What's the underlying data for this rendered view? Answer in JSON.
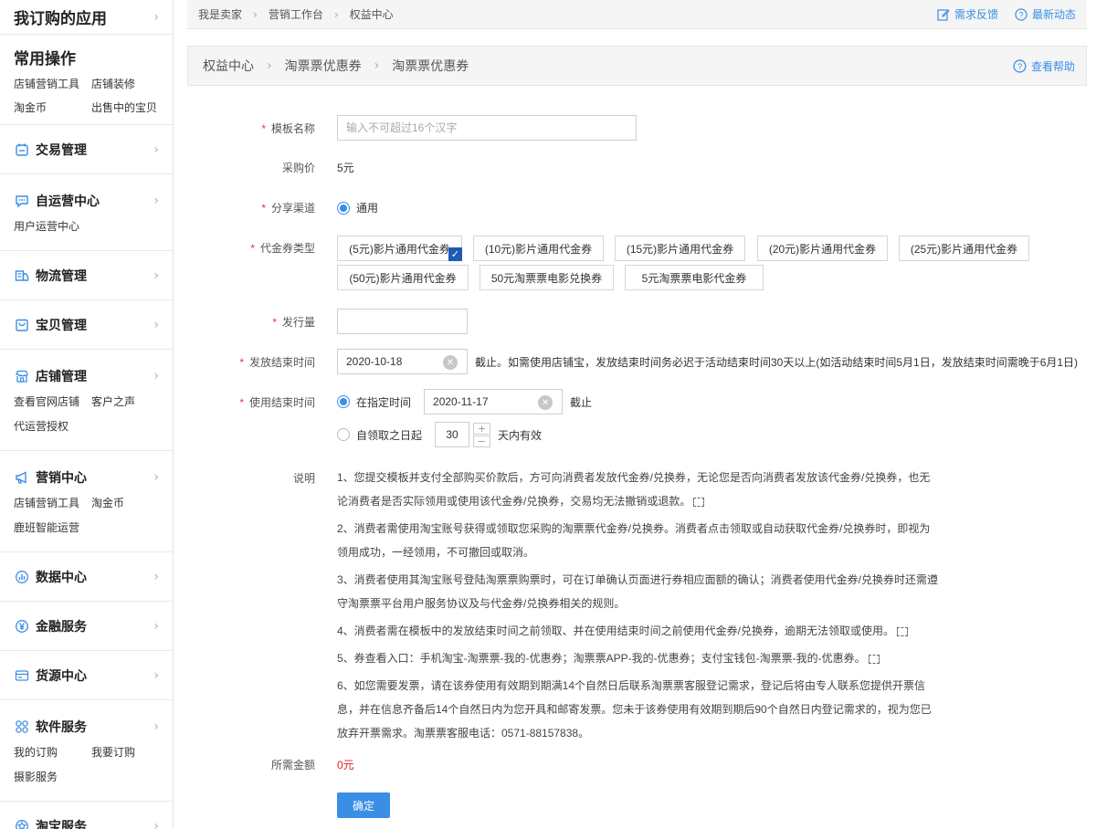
{
  "sidebar": {
    "subscribed_apps": "我订购的应用",
    "common": {
      "title": "常用操作",
      "links": [
        "店铺营销工具",
        "店铺装修",
        "淘金币",
        "出售中的宝贝"
      ]
    },
    "sections": [
      {
        "label": "交易管理",
        "icon": "calendar-icon",
        "sub": []
      },
      {
        "label": "自运营中心",
        "icon": "chat-icon",
        "sub": [
          "用户运营中心"
        ]
      },
      {
        "label": "物流管理",
        "icon": "truck-icon",
        "sub": []
      },
      {
        "label": "宝贝管理",
        "icon": "bag-icon",
        "sub": []
      },
      {
        "label": "店铺管理",
        "icon": "store-icon",
        "sub": [
          "查看官网店铺",
          "客户之声",
          "代运营授权"
        ]
      },
      {
        "label": "营销中心",
        "icon": "megaphone-icon",
        "sub": [
          "店铺营销工具",
          "淘金币",
          "鹿班智能运营"
        ]
      },
      {
        "label": "数据中心",
        "icon": "chart-icon",
        "sub": []
      },
      {
        "label": "金融服务",
        "icon": "yuan-icon",
        "sub": []
      },
      {
        "label": "货源中心",
        "icon": "card-icon",
        "sub": []
      },
      {
        "label": "软件服务",
        "icon": "grid-icon",
        "sub": [
          "我的订购",
          "我要订购",
          "摄影服务"
        ]
      },
      {
        "label": "淘宝服务",
        "icon": "star-icon",
        "sub": []
      }
    ]
  },
  "topbar": {
    "breadcrumb": [
      "我是卖家",
      "营销工作台",
      "权益中心"
    ],
    "feedback": "需求反馈",
    "news": "最新动态"
  },
  "subheader": {
    "breadcrumb": [
      "权益中心",
      "淘票票优惠券",
      "淘票票优惠券"
    ],
    "help": "查看帮助"
  },
  "form": {
    "template_name": {
      "label": "模板名称",
      "placeholder": "输入不可超过16个汉字"
    },
    "purchase_price": {
      "label": "采购价",
      "value": "5元"
    },
    "share_channel": {
      "label": "分享渠道",
      "option": "通用"
    },
    "coupon_type": {
      "label": "代金券类型",
      "options": [
        "(5元)影片通用代金券",
        "(10元)影片通用代金券",
        "(15元)影片通用代金券",
        "(20元)影片通用代金券",
        "(25元)影片通用代金券",
        "(50元)影片通用代金券",
        "50元淘票票电影兑换券",
        "5元淘票票电影代金券"
      ]
    },
    "issue_amount": {
      "label": "发行量",
      "value": ""
    },
    "issue_end": {
      "label": "发放结束时间",
      "value": "2020-10-18",
      "note": "截止。如需使用店铺宝，发放结束时间务必迟于活动结束时间30天以上(如活动结束时间5月1日，发放结束时间需晚于6月1日)"
    },
    "use_end": {
      "label": "使用结束时间",
      "option_fixed": "在指定时间",
      "fixed_value": "2020-11-17",
      "fixed_suffix": "截止",
      "option_relative": "自领取之日起",
      "days": "30",
      "days_suffix": "天内有效"
    },
    "description": {
      "label": "说明",
      "paragraphs": [
        "1、您提交模板并支付全部购买价款后，方可向消费者发放代金券/兑换券，无论您是否向消费者发放该代金券/兑换券，也无论消费者是否实际领用或使用该代金券/兑换券，交易均无法撤销或退款。",
        "2、消费者需使用淘宝账号获得或领取您采购的淘票票代金券/兑换券。消费者点击领取或自动获取代金券/兑换券时，即视为领用成功，一经领用，不可撤回或取消。",
        "3、消费者使用其淘宝账号登陆淘票票购票时，可在订单确认页面进行券相应面额的确认；消费者使用代金券/兑换券时还需遵守淘票票平台用户服务协议及与代金券/兑换券相关的规则。",
        "4、消费者需在模板中的发放结束时间之前领取、并在使用结束时间之前使用代金券/兑换券，逾期无法领取或使用。",
        "5、券查看入口：手机淘宝-淘票票-我的-优惠券；淘票票APP-我的-优惠券；支付宝钱包-淘票票-我的-优惠券。",
        "6、如您需要发票，请在该券使用有效期到期满14个自然日后联系淘票票客服登记需求，登记后将由专人联系您提供开票信息，并在信息齐备后14个自然日内为您开具和邮寄发票。您未于该券使用有效期到期后90个自然日内登记需求的，视为您已放弃开票需求。淘票票客服电话：0571-88157838。"
      ]
    },
    "total": {
      "label": "所需金额",
      "value": "0元"
    },
    "submit": "确定"
  },
  "colors": {
    "accent": "#3a8ee6",
    "required": "#e33333",
    "price": "#e02020",
    "checked": "#1d5bb6"
  }
}
